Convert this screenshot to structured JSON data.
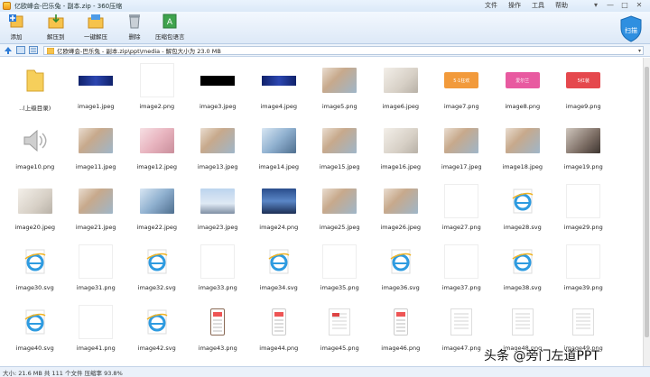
{
  "window": {
    "title": "亿欧峰会-巴乐兔 - 副本.zip - 360压缩",
    "menu": [
      "文件",
      "操作",
      "工具",
      "帮助"
    ],
    "controls": [
      "▾",
      "—",
      "□",
      "✕"
    ]
  },
  "toolbar": {
    "buttons": [
      {
        "label": "添加",
        "icon": "add-icon"
      },
      {
        "label": "解压到",
        "icon": "extract-to-icon"
      },
      {
        "label": "一键解压",
        "icon": "one-click-extract-icon"
      },
      {
        "label": "删除",
        "icon": "delete-trash-icon"
      },
      {
        "label": "压缩包语言",
        "icon": "archive-language-icon"
      }
    ],
    "badge_text": "扫描"
  },
  "address": {
    "path": "亿欧峰会-巴乐兔 - 副本.zip\\ppt\\media - 解包大小为 23.0 MB"
  },
  "files": [
    {
      "name": "..(上级目录)",
      "thumb": "folder"
    },
    {
      "name": "image1.jpeg",
      "thumb": "banner-blue"
    },
    {
      "name": "image2.png",
      "thumb": "blank"
    },
    {
      "name": "image3.jpeg",
      "thumb": "banner-black"
    },
    {
      "name": "image4.jpeg",
      "thumb": "banner-blue"
    },
    {
      "name": "image5.png",
      "thumb": "photo"
    },
    {
      "name": "image6.jpeg",
      "thumb": "photo-light"
    },
    {
      "name": "image7.png",
      "thumb": "ribbon-orange",
      "text": "5·1狂欢"
    },
    {
      "name": "image8.png",
      "thumb": "ribbon-pink",
      "text": "爱尔兰"
    },
    {
      "name": "image9.png",
      "thumb": "ribbon-red",
      "text": "5红装"
    },
    {
      "name": "image10.png",
      "thumb": "speaker"
    },
    {
      "name": "image11.jpeg",
      "thumb": "photo"
    },
    {
      "name": "image12.jpeg",
      "thumb": "photo-pink"
    },
    {
      "name": "image13.jpeg",
      "thumb": "photo"
    },
    {
      "name": "image14.jpeg",
      "thumb": "photo-blue"
    },
    {
      "name": "image15.jpeg",
      "thumb": "photo"
    },
    {
      "name": "image16.jpeg",
      "thumb": "photo-light"
    },
    {
      "name": "image17.jpeg",
      "thumb": "photo"
    },
    {
      "name": "image18.jpeg",
      "thumb": "photo"
    },
    {
      "name": "image19.png",
      "thumb": "photo-dark"
    },
    {
      "name": "image20.jpeg",
      "thumb": "photo-light"
    },
    {
      "name": "image21.jpeg",
      "thumb": "photo"
    },
    {
      "name": "image22.jpeg",
      "thumb": "photo-blue"
    },
    {
      "name": "image23.jpeg",
      "thumb": "photo-sky"
    },
    {
      "name": "image24.png",
      "thumb": "photo-city"
    },
    {
      "name": "image25.jpeg",
      "thumb": "photo"
    },
    {
      "name": "image26.jpeg",
      "thumb": "photo"
    },
    {
      "name": "image27.png",
      "thumb": "blank"
    },
    {
      "name": "image28.svg",
      "thumb": "ie"
    },
    {
      "name": "image29.png",
      "thumb": "blank"
    },
    {
      "name": "image30.svg",
      "thumb": "ie"
    },
    {
      "name": "image31.png",
      "thumb": "blank"
    },
    {
      "name": "image32.svg",
      "thumb": "ie"
    },
    {
      "name": "image33.png",
      "thumb": "blank"
    },
    {
      "name": "image34.svg",
      "thumb": "ie"
    },
    {
      "name": "image35.png",
      "thumb": "blank"
    },
    {
      "name": "image36.svg",
      "thumb": "ie"
    },
    {
      "name": "image37.png",
      "thumb": "blank"
    },
    {
      "name": "image38.svg",
      "thumb": "ie"
    },
    {
      "name": "image39.png",
      "thumb": "blank"
    },
    {
      "name": "image40.svg",
      "thumb": "ie"
    },
    {
      "name": "image41.png",
      "thumb": "blank"
    },
    {
      "name": "image42.svg",
      "thumb": "ie"
    },
    {
      "name": "image43.png",
      "thumb": "phone-hand"
    },
    {
      "name": "image44.png",
      "thumb": "phone"
    },
    {
      "name": "image45.png",
      "thumb": "doc-red"
    },
    {
      "name": "image46.png",
      "thumb": "phone"
    },
    {
      "name": "image47.png",
      "thumb": "doc"
    },
    {
      "name": "image48.png",
      "thumb": "doc"
    },
    {
      "name": "image49.png",
      "thumb": "doc"
    }
  ],
  "status": {
    "text": "大小: 21.6 MB 共 111 个文件 压缩率 93.8%"
  },
  "watermark": {
    "text": "头条 @旁门左道PPT"
  }
}
